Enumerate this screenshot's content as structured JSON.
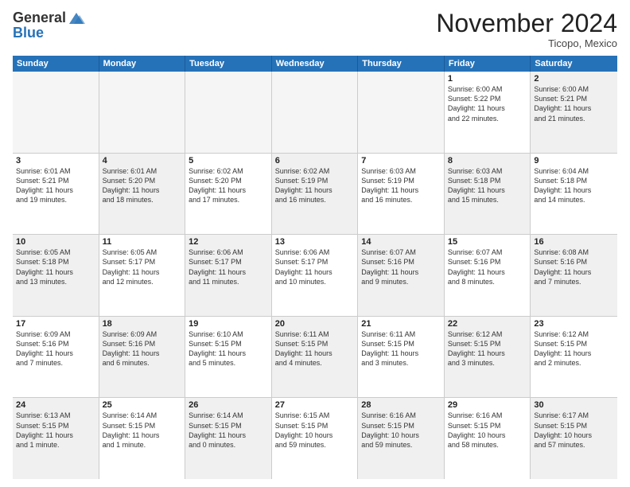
{
  "logo": {
    "general": "General",
    "blue": "Blue"
  },
  "header": {
    "month": "November 2024",
    "location": "Ticopo, Mexico"
  },
  "weekdays": [
    "Sunday",
    "Monday",
    "Tuesday",
    "Wednesday",
    "Thursday",
    "Friday",
    "Saturday"
  ],
  "weeks": [
    [
      {
        "day": "",
        "text": "",
        "empty": true
      },
      {
        "day": "",
        "text": "",
        "empty": true
      },
      {
        "day": "",
        "text": "",
        "empty": true
      },
      {
        "day": "",
        "text": "",
        "empty": true
      },
      {
        "day": "",
        "text": "",
        "empty": true
      },
      {
        "day": "1",
        "text": "Sunrise: 6:00 AM\nSunset: 5:22 PM\nDaylight: 11 hours\nand 22 minutes.",
        "empty": false,
        "alt": false
      },
      {
        "day": "2",
        "text": "Sunrise: 6:00 AM\nSunset: 5:21 PM\nDaylight: 11 hours\nand 21 minutes.",
        "empty": false,
        "alt": true
      }
    ],
    [
      {
        "day": "3",
        "text": "Sunrise: 6:01 AM\nSunset: 5:21 PM\nDaylight: 11 hours\nand 19 minutes.",
        "empty": false,
        "alt": false
      },
      {
        "day": "4",
        "text": "Sunrise: 6:01 AM\nSunset: 5:20 PM\nDaylight: 11 hours\nand 18 minutes.",
        "empty": false,
        "alt": true
      },
      {
        "day": "5",
        "text": "Sunrise: 6:02 AM\nSunset: 5:20 PM\nDaylight: 11 hours\nand 17 minutes.",
        "empty": false,
        "alt": false
      },
      {
        "day": "6",
        "text": "Sunrise: 6:02 AM\nSunset: 5:19 PM\nDaylight: 11 hours\nand 16 minutes.",
        "empty": false,
        "alt": true
      },
      {
        "day": "7",
        "text": "Sunrise: 6:03 AM\nSunset: 5:19 PM\nDaylight: 11 hours\nand 16 minutes.",
        "empty": false,
        "alt": false
      },
      {
        "day": "8",
        "text": "Sunrise: 6:03 AM\nSunset: 5:18 PM\nDaylight: 11 hours\nand 15 minutes.",
        "empty": false,
        "alt": true
      },
      {
        "day": "9",
        "text": "Sunrise: 6:04 AM\nSunset: 5:18 PM\nDaylight: 11 hours\nand 14 minutes.",
        "empty": false,
        "alt": false
      }
    ],
    [
      {
        "day": "10",
        "text": "Sunrise: 6:05 AM\nSunset: 5:18 PM\nDaylight: 11 hours\nand 13 minutes.",
        "empty": false,
        "alt": true
      },
      {
        "day": "11",
        "text": "Sunrise: 6:05 AM\nSunset: 5:17 PM\nDaylight: 11 hours\nand 12 minutes.",
        "empty": false,
        "alt": false
      },
      {
        "day": "12",
        "text": "Sunrise: 6:06 AM\nSunset: 5:17 PM\nDaylight: 11 hours\nand 11 minutes.",
        "empty": false,
        "alt": true
      },
      {
        "day": "13",
        "text": "Sunrise: 6:06 AM\nSunset: 5:17 PM\nDaylight: 11 hours\nand 10 minutes.",
        "empty": false,
        "alt": false
      },
      {
        "day": "14",
        "text": "Sunrise: 6:07 AM\nSunset: 5:16 PM\nDaylight: 11 hours\nand 9 minutes.",
        "empty": false,
        "alt": true
      },
      {
        "day": "15",
        "text": "Sunrise: 6:07 AM\nSunset: 5:16 PM\nDaylight: 11 hours\nand 8 minutes.",
        "empty": false,
        "alt": false
      },
      {
        "day": "16",
        "text": "Sunrise: 6:08 AM\nSunset: 5:16 PM\nDaylight: 11 hours\nand 7 minutes.",
        "empty": false,
        "alt": true
      }
    ],
    [
      {
        "day": "17",
        "text": "Sunrise: 6:09 AM\nSunset: 5:16 PM\nDaylight: 11 hours\nand 7 minutes.",
        "empty": false,
        "alt": false
      },
      {
        "day": "18",
        "text": "Sunrise: 6:09 AM\nSunset: 5:16 PM\nDaylight: 11 hours\nand 6 minutes.",
        "empty": false,
        "alt": true
      },
      {
        "day": "19",
        "text": "Sunrise: 6:10 AM\nSunset: 5:15 PM\nDaylight: 11 hours\nand 5 minutes.",
        "empty": false,
        "alt": false
      },
      {
        "day": "20",
        "text": "Sunrise: 6:11 AM\nSunset: 5:15 PM\nDaylight: 11 hours\nand 4 minutes.",
        "empty": false,
        "alt": true
      },
      {
        "day": "21",
        "text": "Sunrise: 6:11 AM\nSunset: 5:15 PM\nDaylight: 11 hours\nand 3 minutes.",
        "empty": false,
        "alt": false
      },
      {
        "day": "22",
        "text": "Sunrise: 6:12 AM\nSunset: 5:15 PM\nDaylight: 11 hours\nand 3 minutes.",
        "empty": false,
        "alt": true
      },
      {
        "day": "23",
        "text": "Sunrise: 6:12 AM\nSunset: 5:15 PM\nDaylight: 11 hours\nand 2 minutes.",
        "empty": false,
        "alt": false
      }
    ],
    [
      {
        "day": "24",
        "text": "Sunrise: 6:13 AM\nSunset: 5:15 PM\nDaylight: 11 hours\nand 1 minute.",
        "empty": false,
        "alt": true
      },
      {
        "day": "25",
        "text": "Sunrise: 6:14 AM\nSunset: 5:15 PM\nDaylight: 11 hours\nand 1 minute.",
        "empty": false,
        "alt": false
      },
      {
        "day": "26",
        "text": "Sunrise: 6:14 AM\nSunset: 5:15 PM\nDaylight: 11 hours\nand 0 minutes.",
        "empty": false,
        "alt": true
      },
      {
        "day": "27",
        "text": "Sunrise: 6:15 AM\nSunset: 5:15 PM\nDaylight: 10 hours\nand 59 minutes.",
        "empty": false,
        "alt": false
      },
      {
        "day": "28",
        "text": "Sunrise: 6:16 AM\nSunset: 5:15 PM\nDaylight: 10 hours\nand 59 minutes.",
        "empty": false,
        "alt": true
      },
      {
        "day": "29",
        "text": "Sunrise: 6:16 AM\nSunset: 5:15 PM\nDaylight: 10 hours\nand 58 minutes.",
        "empty": false,
        "alt": false
      },
      {
        "day": "30",
        "text": "Sunrise: 6:17 AM\nSunset: 5:15 PM\nDaylight: 10 hours\nand 57 minutes.",
        "empty": false,
        "alt": true
      }
    ]
  ]
}
